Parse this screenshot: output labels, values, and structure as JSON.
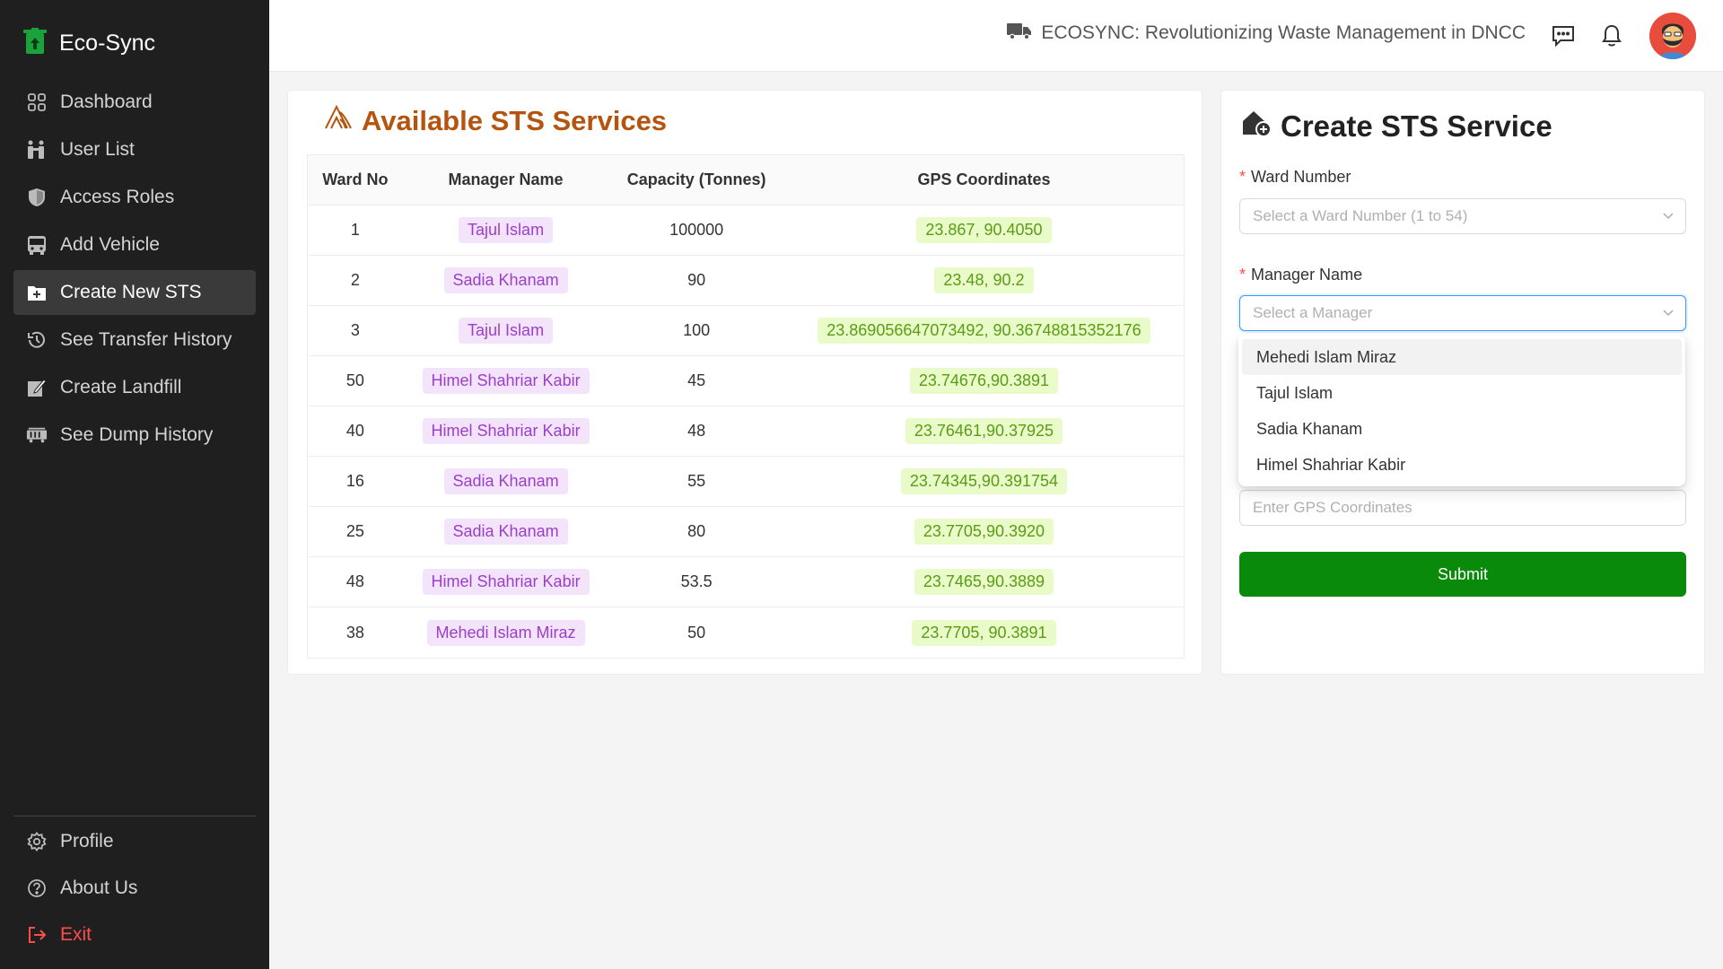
{
  "app": {
    "name": "Eco-Sync"
  },
  "sidebar": {
    "items": [
      {
        "label": "Dashboard",
        "icon": "dashboard-icon"
      },
      {
        "label": "User List",
        "icon": "users-icon"
      },
      {
        "label": "Access Roles",
        "icon": "shield-icon"
      },
      {
        "label": "Add Vehicle",
        "icon": "bus-icon"
      },
      {
        "label": "Create New STS",
        "icon": "folder-plus-icon",
        "active": true
      },
      {
        "label": "See Transfer History",
        "icon": "history-icon"
      },
      {
        "label": "Create Landfill",
        "icon": "edit-icon"
      },
      {
        "label": "See Dump History",
        "icon": "truck-icon"
      }
    ],
    "bottom": [
      {
        "label": "Profile",
        "icon": "gear-icon"
      },
      {
        "label": "About Us",
        "icon": "help-icon"
      },
      {
        "label": "Exit",
        "icon": "logout-icon"
      }
    ]
  },
  "header": {
    "title": "ECOSYNC: Revolutionizing Waste Management in DNCC"
  },
  "sts_table": {
    "title": "Available STS Services",
    "columns": [
      "Ward No",
      "Manager Name",
      "Capacity (Tonnes)",
      "GPS Coordinates"
    ],
    "rows": [
      {
        "ward": "1",
        "manager": "Tajul Islam",
        "capacity": "100000",
        "gps": "23.867, 90.4050"
      },
      {
        "ward": "2",
        "manager": "Sadia Khanam",
        "capacity": "90",
        "gps": "23.48, 90.2"
      },
      {
        "ward": "3",
        "manager": "Tajul Islam",
        "capacity": "100",
        "gps": "23.869056647073492, 90.36748815352176"
      },
      {
        "ward": "50",
        "manager": "Himel Shahriar Kabir",
        "capacity": "45",
        "gps": "23.74676,90.3891"
      },
      {
        "ward": "40",
        "manager": "Himel Shahriar Kabir",
        "capacity": "48",
        "gps": "23.76461,90.37925"
      },
      {
        "ward": "16",
        "manager": "Sadia Khanam",
        "capacity": "55",
        "gps": "23.74345,90.391754"
      },
      {
        "ward": "25",
        "manager": "Sadia Khanam",
        "capacity": "80",
        "gps": "23.7705,90.3920"
      },
      {
        "ward": "48",
        "manager": "Himel Shahriar Kabir",
        "capacity": "53.5",
        "gps": "23.7465,90.3889"
      },
      {
        "ward": "38",
        "manager": "Mehedi Islam Miraz",
        "capacity": "50",
        "gps": "23.7705, 90.3891"
      }
    ]
  },
  "form": {
    "title": "Create STS Service",
    "ward_label": "Ward Number",
    "ward_placeholder": "Select a Ward Number (1 to 54)",
    "manager_label": "Manager Name",
    "manager_placeholder": "Select a Manager",
    "manager_options": [
      "Mehedi Islam Miraz",
      "Tajul Islam",
      "Sadia Khanam",
      "Himel Shahriar Kabir"
    ],
    "gps_placeholder": "Enter GPS Coordinates",
    "submit_label": "Submit"
  },
  "colors": {
    "sidebar_bg": "#1f1f1f",
    "title_orange": "#b5540f",
    "submit_green": "#0a8a0a",
    "exit_red": "#ff4d4f"
  }
}
